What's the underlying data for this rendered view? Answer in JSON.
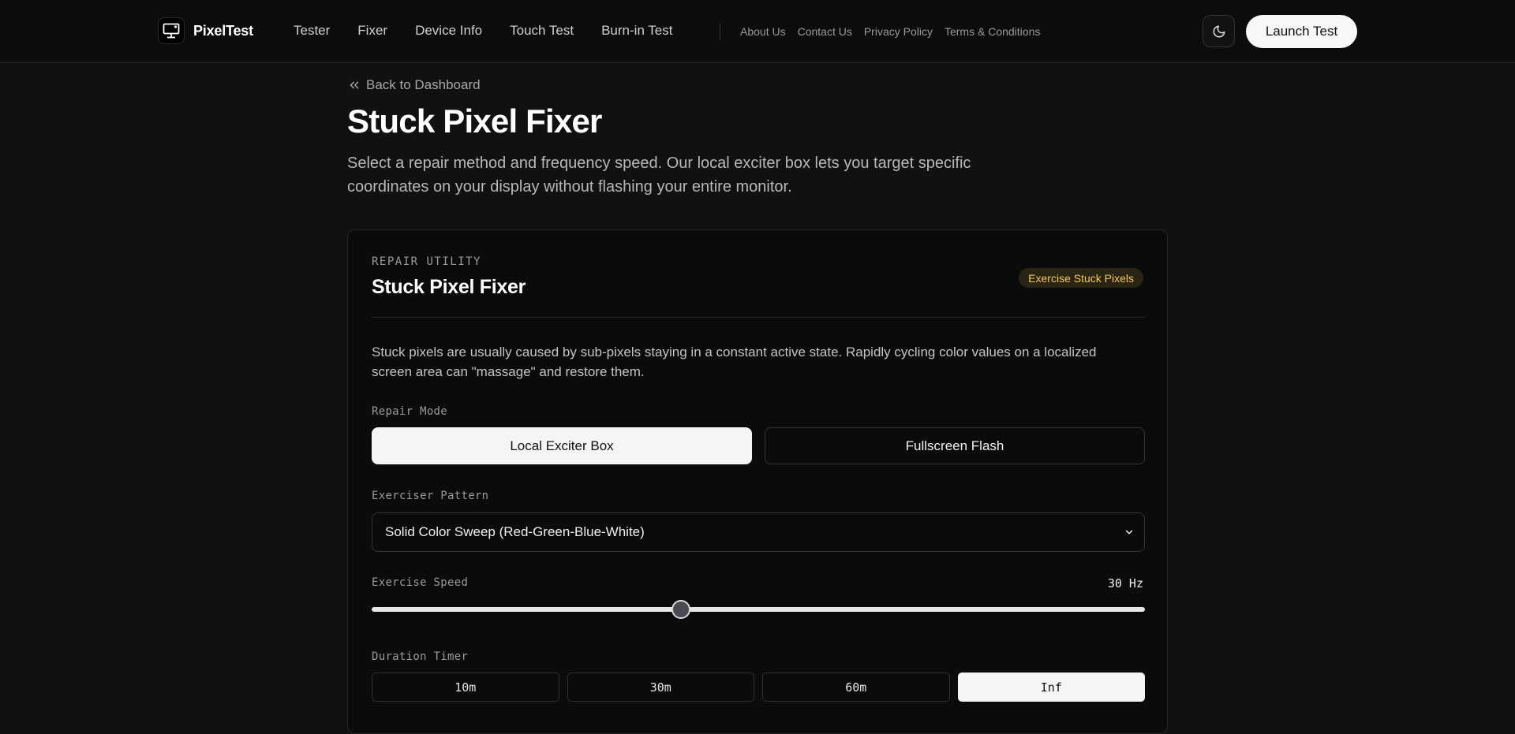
{
  "header": {
    "brand": "PixelTest",
    "nav_main": [
      "Tester",
      "Fixer",
      "Device Info",
      "Touch Test",
      "Burn-in Test"
    ],
    "nav_secondary": [
      "About Us",
      "Contact Us",
      "Privacy Policy",
      "Terms & Conditions"
    ],
    "theme_icon": "moon-icon",
    "launch_label": "Launch Test"
  },
  "page": {
    "back_label": "Back to Dashboard",
    "title": "Stuck Pixel Fixer",
    "description": "Select a repair method and frequency speed. Our local exciter box lets you target specific coordinates on your display without flashing your entire monitor."
  },
  "card": {
    "kicker": "REPAIR UTILITY",
    "title": "Stuck Pixel Fixer",
    "badge": "Exercise Stuck Pixels",
    "text": "Stuck pixels are usually caused by sub-pixels staying in a constant active state. Rapidly cycling color values on a localized screen area can \"massage\" and restore them.",
    "repair_mode": {
      "label": "Repair Mode",
      "options": [
        "Local Exciter Box",
        "Fullscreen Flash"
      ],
      "selected": "Local Exciter Box"
    },
    "pattern": {
      "label": "Exerciser Pattern",
      "selected": "Solid Color Sweep (Red-Green-Blue-White)"
    },
    "speed": {
      "label": "Exercise Speed",
      "value_text": "30 Hz",
      "slider_fraction": 0.4
    },
    "duration": {
      "label": "Duration Timer",
      "options": [
        "10m",
        "30m",
        "60m",
        "Inf"
      ],
      "selected": "Inf"
    }
  },
  "colors": {
    "background": "#111111",
    "badge_text": "#f2c75c",
    "badge_bg": "#2a2414"
  }
}
